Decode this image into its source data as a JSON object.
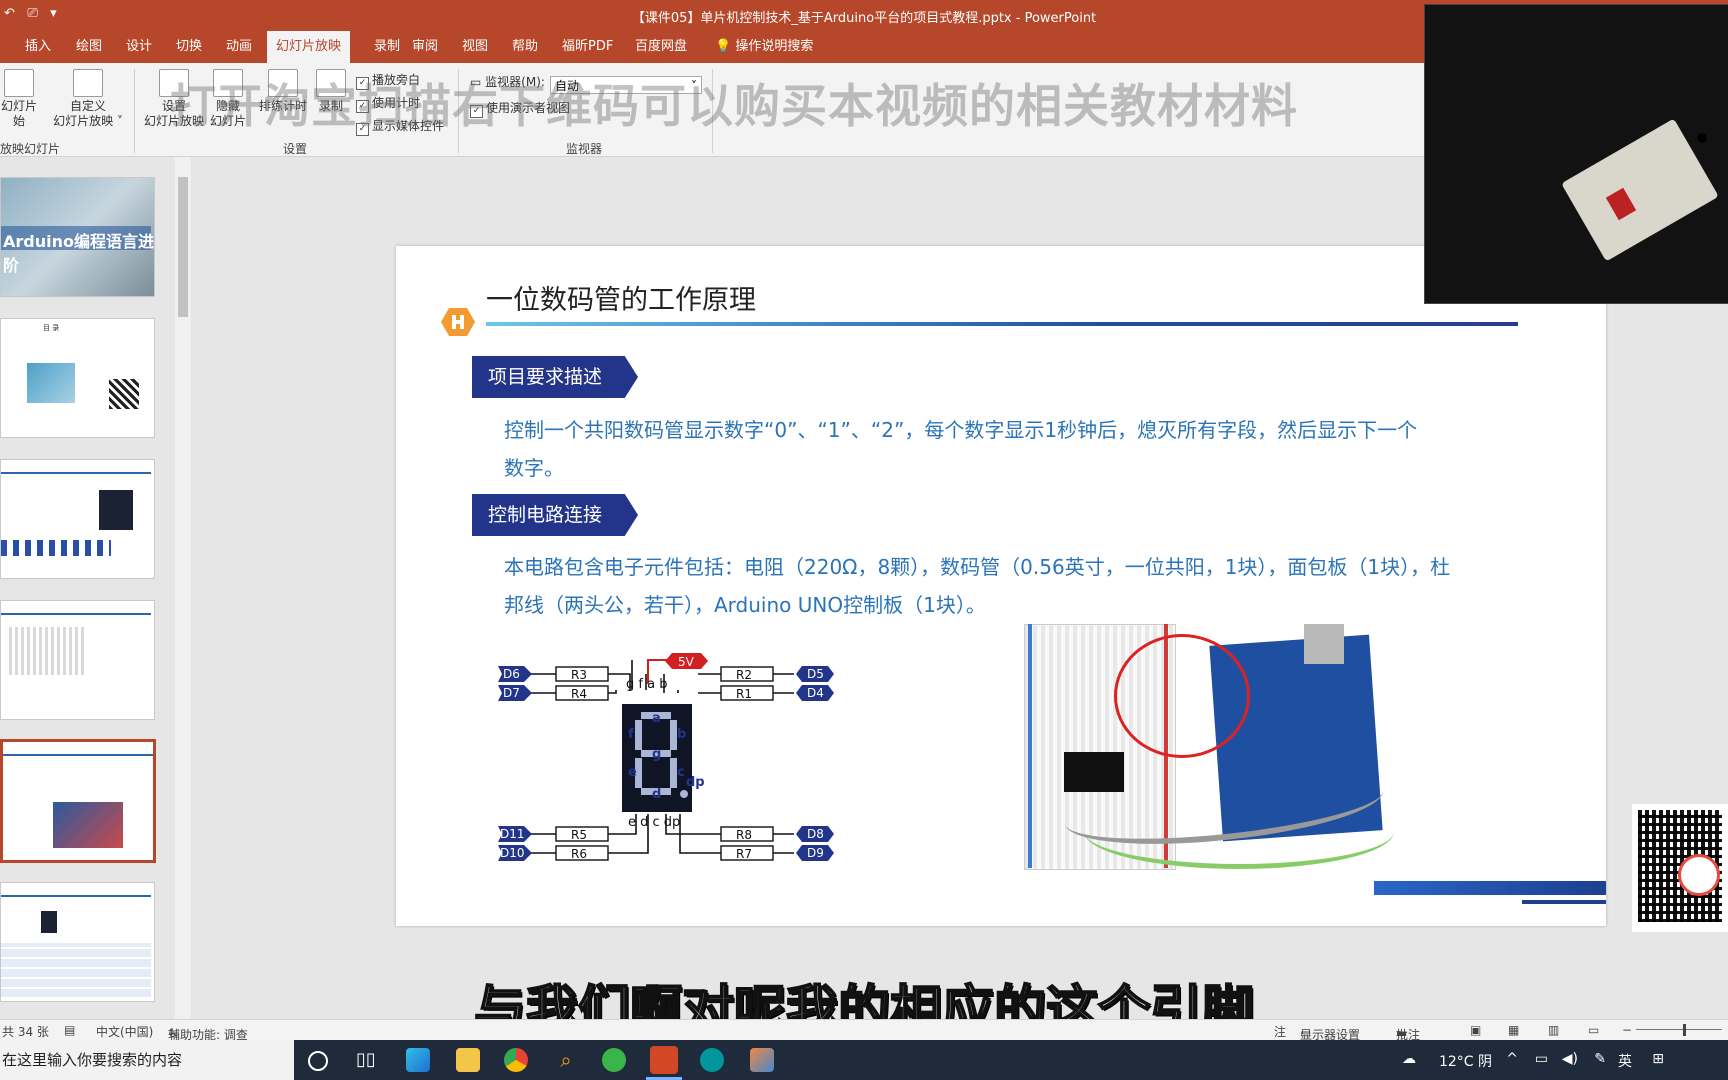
{
  "window": {
    "title": "【课件05】单片机控制技术_基于Arduino平台的项目式教程.pptx  -  PowerPoint"
  },
  "tabs": [
    "插入",
    "绘图",
    "设计",
    "切换",
    "动画",
    "幻灯片放映",
    "录制",
    "审阅",
    "视图",
    "帮助",
    "福昕PDF",
    "百度网盘"
  ],
  "active_tab": "幻灯片放映",
  "tell_me": "操作说明搜索",
  "ribbon": {
    "start_slideshow": {
      "line1": "幻灯片",
      "line2": "始"
    },
    "custom_show": {
      "line1": "自定义",
      "line2": "幻灯片放映"
    },
    "group_start_label": "放映幻灯片",
    "setup_show": {
      "line1": "设置",
      "line2": "幻灯片放映"
    },
    "hide_slide": {
      "line1": "隐藏",
      "line2": "幻灯片"
    },
    "rehearse": "排练计时",
    "record": "录制",
    "chk_narration": "播放旁白",
    "chk_timings": "使用计时",
    "chk_media": "显示媒体控件",
    "group_setup_label": "设置",
    "monitor_label": "监视器(M):",
    "monitor_value": "自动",
    "chk_presenter": "使用演示者视图",
    "group_monitor_label": "监视器"
  },
  "watermark": "打开淘宝扫描右下维码可以购买本视频的相关教材材料",
  "thumbnails": {
    "t1_banner": "Arduino编程语言进阶",
    "t2_title": "目 录"
  },
  "slide": {
    "title": "一位数码管的工作原理",
    "section1": "项目要求描述",
    "section1_text_line1": "控制一个共阳数码管显示数字“0”、“1”、“2”，每个数字显示1秒钟后，熄灭所有字段，然后显示下一个",
    "section1_text_line2": "数字。",
    "section2": "控制电路连接",
    "section2_text_line1": "本电路包含电子元件包括：电阻（220Ω，8颗），数码管（0.56英寸，一位共阳，1块），面包板（1块），杜",
    "section2_text_line2": "邦线（两头公，若干），Arduino UNO控制板（1块）。",
    "circuit": {
      "pins_left_top": [
        "D6",
        "D7"
      ],
      "pins_right_top": [
        "D5",
        "D4"
      ],
      "pins_left_bottom": [
        "D11",
        "D10"
      ],
      "pins_right_bottom": [
        "D8",
        "D9"
      ],
      "res_left_top": [
        "R3",
        "R4"
      ],
      "res_right_top": [
        "R2",
        "R1"
      ],
      "res_left_bottom": [
        "R5",
        "R6"
      ],
      "res_right_bottom": [
        "R8",
        "R7"
      ],
      "power": "5V",
      "top_pins": "g f  a b",
      "bottom_pins": "e d  c dp",
      "seg_letters": [
        "a",
        "f",
        "b",
        "g",
        "e",
        "c",
        "d",
        "dp"
      ]
    }
  },
  "subtitle": "与我们啊对呢我的相应的这个引脚",
  "statusbar": {
    "slide_count": "共 34 张",
    "language": "中文(中国)",
    "accessibility": "辅助功能: 调查",
    "notes": "注",
    "display_settings": "显示器设置",
    "comments": "批注"
  },
  "taskbar": {
    "search_placeholder": "在这里输入你要搜索的内容",
    "weather": "12°C 阴",
    "ime": "英"
  },
  "colors": {
    "accent": "#b7472a",
    "slide_blue": "#22358a",
    "text_blue": "#2b74b8"
  }
}
